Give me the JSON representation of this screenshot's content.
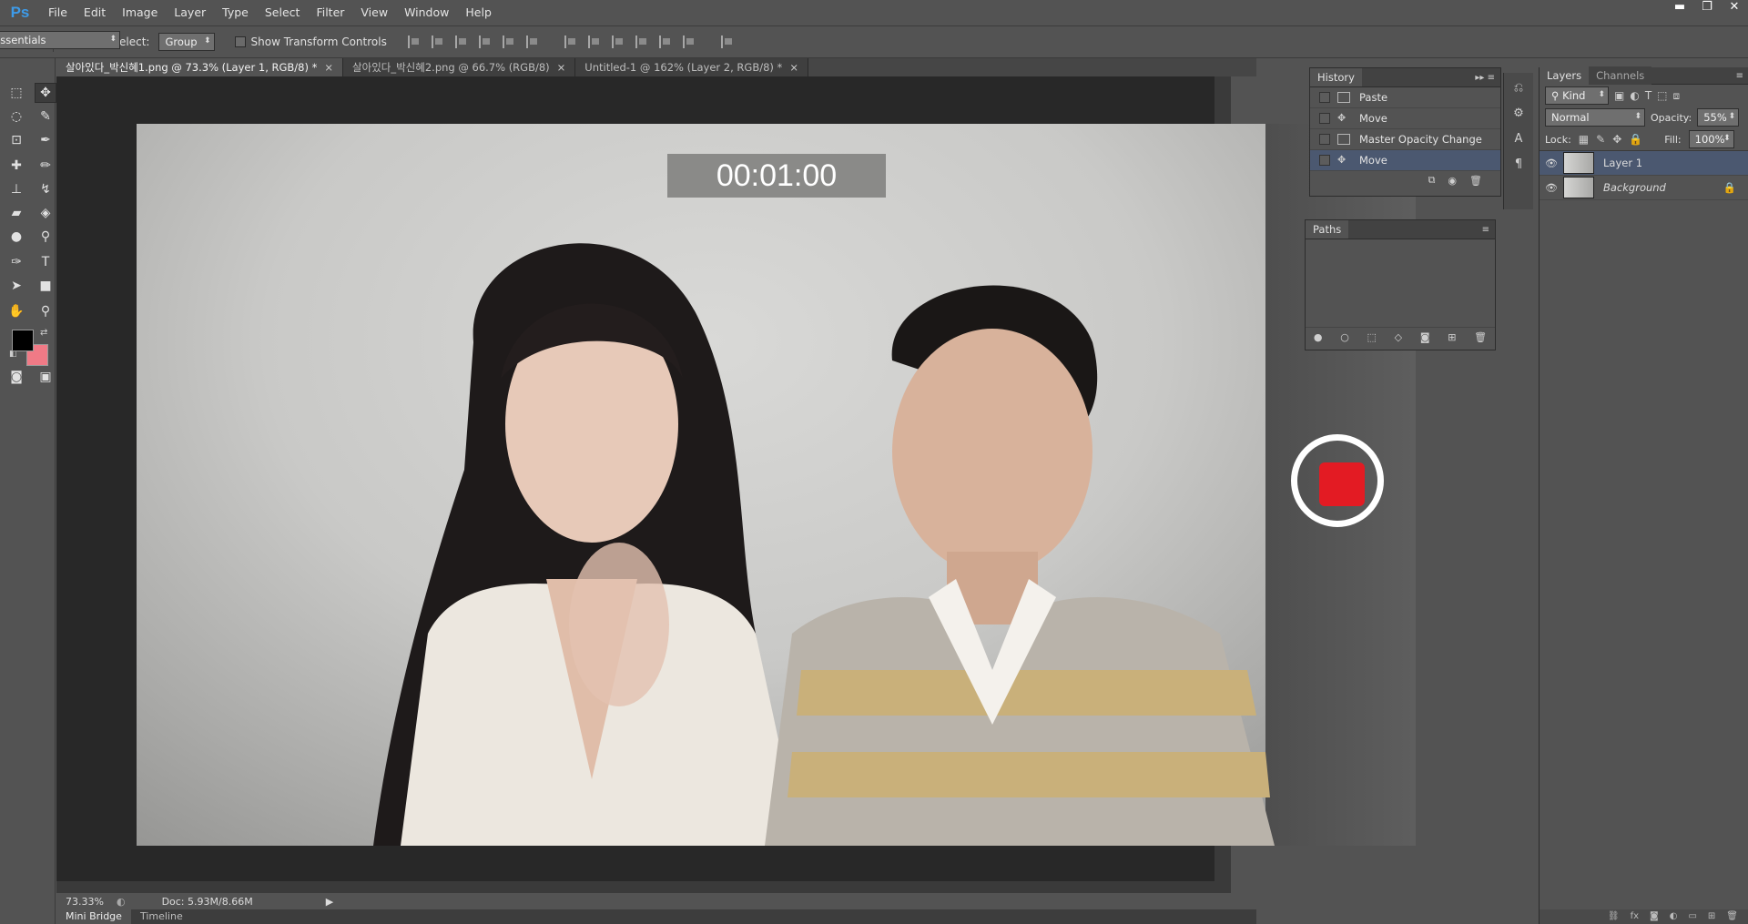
{
  "app": {
    "logo": "Ps"
  },
  "menu": [
    "File",
    "Edit",
    "Image",
    "Layer",
    "Type",
    "Select",
    "Filter",
    "View",
    "Window",
    "Help"
  ],
  "window_controls": [
    "▬",
    "❐",
    "✕"
  ],
  "options": {
    "auto_select_label": "Auto-Select:",
    "auto_select_value": "Group",
    "transform_label": "Show Transform Controls",
    "workspace": "Essentials"
  },
  "tabs": [
    {
      "label": "살아있다_박신혜1.png @ 73.3% (Layer 1, RGB/8) *",
      "active": true
    },
    {
      "label": "살아있다_박신혜2.png @ 66.7% (RGB/8)",
      "active": false
    },
    {
      "label": "Untitled-1 @ 162% (Layer 2, RGB/8) *",
      "active": false
    }
  ],
  "tab_close": "×",
  "overlay": {
    "timer": "00:01:00"
  },
  "status": {
    "zoom": "73.33%",
    "doc": "Doc: 5.93M/8.66M"
  },
  "bottom_tabs": [
    "Mini Bridge",
    "Timeline"
  ],
  "history": {
    "title": "History",
    "items": [
      "Paste",
      "Move",
      "Master Opacity Change",
      "Move"
    ]
  },
  "paths": {
    "title": "Paths"
  },
  "layers": {
    "tabs": [
      "Layers",
      "Channels"
    ],
    "kind": "Kind",
    "blend_mode": "Normal",
    "opacity_label": "Opacity:",
    "opacity_value": "55%",
    "lock_label": "Lock:",
    "fill_label": "Fill:",
    "fill_value": "100%",
    "items": [
      {
        "name": "Layer 1",
        "selected": true
      },
      {
        "name": "Background",
        "selected": false
      }
    ]
  },
  "colors": {
    "accent": "#3d9be9",
    "record": "#e31b23",
    "selection": "#4b5870",
    "background_swatch": "#f07a86"
  }
}
